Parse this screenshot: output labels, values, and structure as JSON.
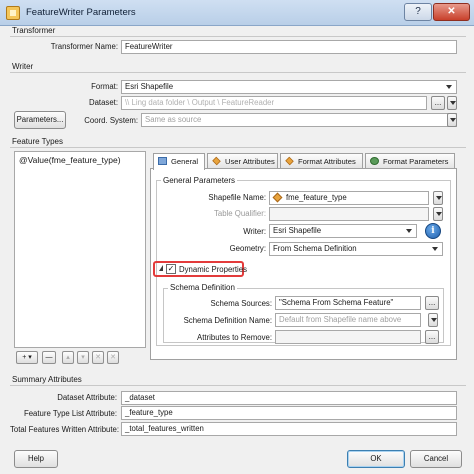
{
  "window": {
    "title": "FeatureWriter Parameters",
    "help_glyph": "?",
    "close_glyph": "✕"
  },
  "transformer": {
    "section_title": "Transformer",
    "name_label": "Transformer Name:",
    "name_value": "FeatureWriter"
  },
  "writer": {
    "section_title": "Writer",
    "format_label": "Format:",
    "format_value": "Esri Shapefile",
    "dataset_label": "Dataset:",
    "dataset_value": "\\\\ Ling data folder \\ Output \\ FeatureReader",
    "dataset_browse": "...",
    "parameters_button": "Parameters...",
    "coord_label": "Coord. System:",
    "coord_value": "Same as source"
  },
  "feature_types": {
    "section_title": "Feature Types",
    "items": [
      "@Value(fme_feature_type)"
    ],
    "toolbar": [
      "+ ▾",
      "—",
      "▴",
      "▾",
      "✕",
      "✕"
    ]
  },
  "tabs": [
    {
      "label": "General",
      "active": true
    },
    {
      "label": "User Attributes",
      "active": false
    },
    {
      "label": "Format Attributes",
      "active": false
    },
    {
      "label": "Format Parameters",
      "active": false
    }
  ],
  "general": {
    "group_title": "General Parameters",
    "shapefile_name_label": "Shapefile Name:",
    "shapefile_name_value": "fme_feature_type",
    "table_qualifier_label": "Table Qualifier:",
    "table_qualifier_value": "",
    "writer_label": "Writer:",
    "writer_value": "Esri Shapefile",
    "geometry_label": "Geometry:",
    "geometry_value": "From Schema Definition",
    "dynamic_properties_label": "Dynamic Properties",
    "dynamic_properties_checked": true,
    "info_glyph": "i",
    "browse_glyph": "..."
  },
  "schema": {
    "group_title": "Schema Definition",
    "sources_label": "Schema Sources:",
    "sources_value": "\"Schema From Schema Feature\"",
    "definition_name_label": "Schema Definition Name:",
    "definition_name_placeholder": "Default from Shapefile name above",
    "remove_label": "Attributes to Remove:",
    "remove_value": ""
  },
  "summary": {
    "section_title": "Summary Attributes",
    "dataset_attr_label": "Dataset Attribute:",
    "dataset_attr_value": "_dataset",
    "ftl_label": "Feature Type List Attribute:",
    "ftl_value": "_feature_type",
    "total_label": "Total Features Written Attribute:",
    "total_value": "_total_features_written"
  },
  "footer": {
    "help_button": "Help",
    "ok_button": "OK",
    "cancel_button": "Cancel"
  },
  "colors": {
    "highlight": "#e33b3b",
    "titlebar": "#b9cfe8",
    "close": "#c8402b"
  }
}
